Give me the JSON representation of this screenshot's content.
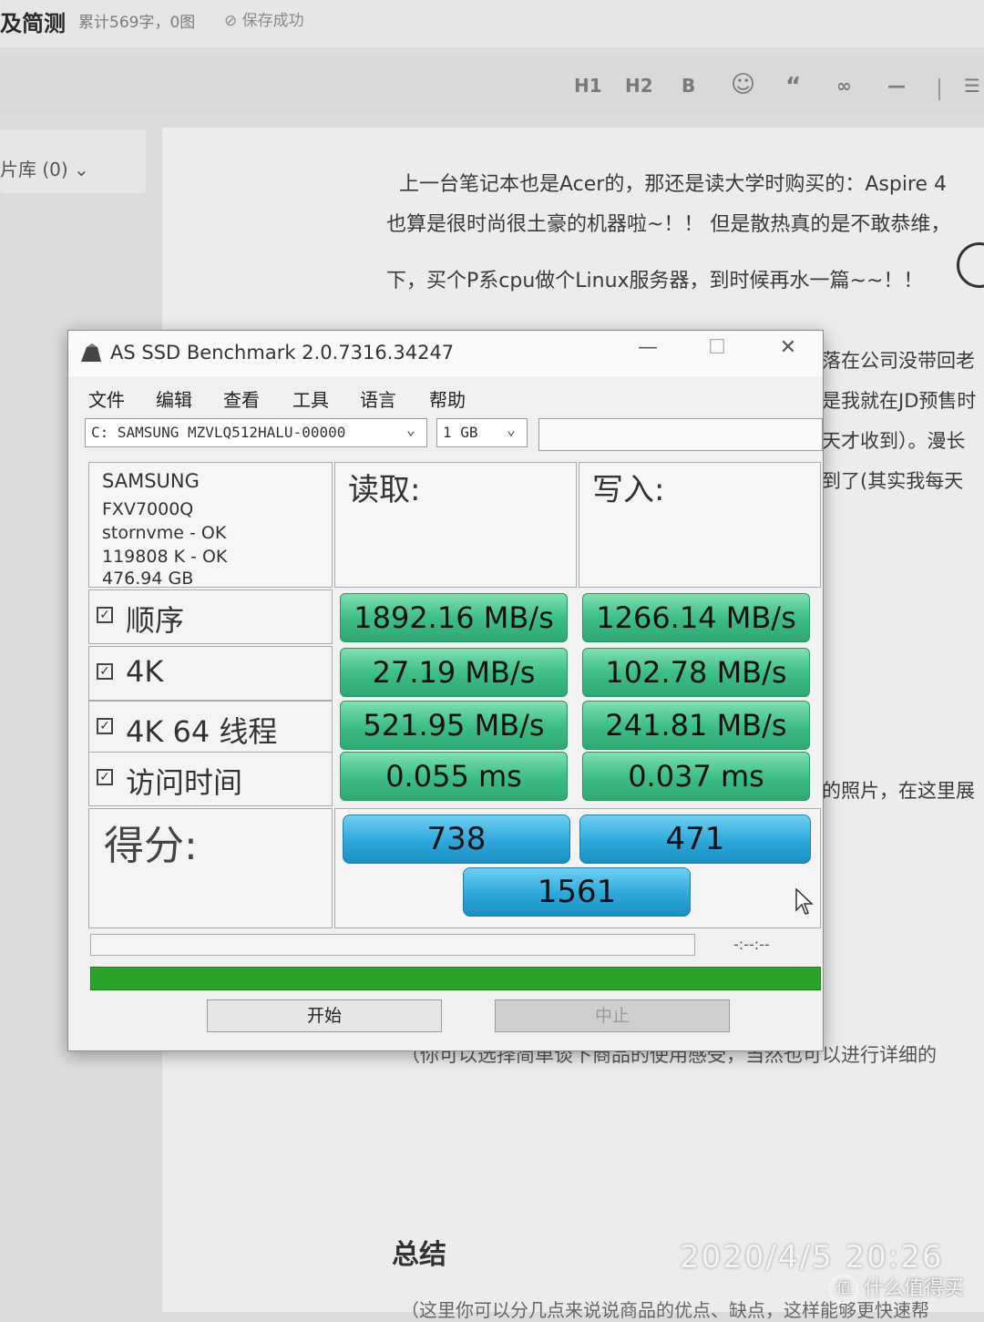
{
  "editor": {
    "brand": "及简测",
    "stats": "累计569字，0图",
    "saved_icon": "check-circle-icon",
    "saved": "保存成功",
    "toolbar": [
      "H1",
      "H2",
      "B",
      "☺",
      "“",
      "∞",
      "—",
      "☰"
    ],
    "sidebar_label": "片库 (0) ⌄",
    "paragraphs": [
      "上一台笔记本也是Acer的，那还是读大学时购买的：Aspire 4",
      "也算是很时尚很土豪的机器啦~！！ 但是散热真的是不敢恭维，",
      "下，买个P系cpu做个Linux服务器，到时候再水一篇~~！！"
    ],
    "side_fragments": [
      "落在公司没带回老",
      "是我就在JD预售时",
      "天才收到）。漫长",
      "到了(其实我每天",
      "的照片，在这里展"
    ],
    "under_text": "（你可以选择简单谈下商品的使用感受，当然也可以进行详细的",
    "summary_heading": "总结",
    "bottom_text": "（这里你可以分几点来说说商品的优点、缺点，这样能够更快速帮"
  },
  "window": {
    "title": "AS SSD Benchmark 2.0.7316.34247",
    "menu": [
      "文件",
      "编辑",
      "查看",
      "工具",
      "语言",
      "帮助"
    ],
    "drive_select": "C: SAMSUNG MZVLQ512HALU-00000",
    "size_select": "1 GB",
    "drive_info": [
      "SAMSUNG",
      "FXV7000Q",
      "stornvme - OK",
      "119808 K - OK",
      "476.94 GB"
    ],
    "read_header": "读取:",
    "write_header": "写入:",
    "tests": [
      {
        "label": "顺序",
        "read": "1892.16 MB/s",
        "write": "1266.14 MB/s"
      },
      {
        "label": "4K",
        "read": "27.19 MB/s",
        "write": "102.78 MB/s"
      },
      {
        "label": "4K 64 线程",
        "read": "521.95 MB/s",
        "write": "241.81 MB/s"
      },
      {
        "label": "访问时间",
        "read": "0.055 ms",
        "write": "0.037 ms"
      }
    ],
    "score_label": "得分:",
    "score_read": "738",
    "score_write": "471",
    "score_total": "1561",
    "time_display": "-:--:--",
    "start_button": "开始",
    "stop_button": "中止",
    "progress": 1.0
  },
  "photo_stamp": "2020/4/5  20:26",
  "watermark": "什么值得买"
}
